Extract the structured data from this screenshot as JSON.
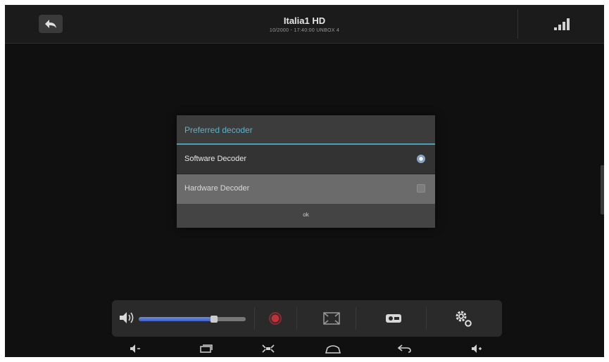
{
  "header": {
    "channel_name": "Italia1 HD",
    "channel_info": "10/2000 - 17:40:00 UNBOX 4",
    "back_icon": "back-arrow-icon",
    "signal_icon": "signal-strength-icon"
  },
  "dialog": {
    "title": "Preferred decoder",
    "options": [
      {
        "label": "Software Decoder",
        "selected": true
      },
      {
        "label": "Hardware Decoder",
        "selected": false
      }
    ],
    "ok_label": "ok"
  },
  "controls": {
    "volume_level": 0.72,
    "volume_icon": "speaker-icon",
    "record_icon": "record-icon",
    "aspect_icon": "aspect-ratio-icon",
    "subtitle_icon": "audio-track-icon",
    "settings_icon": "gear-icon"
  },
  "navigation": {
    "items": [
      "volume-down-icon",
      "recent-apps-icon",
      "screenshot-icon",
      "home-icon",
      "back-icon",
      "volume-up-icon"
    ]
  },
  "colors": {
    "accent": "#4a9fb5",
    "slider_fill": "#3d5fc2",
    "record": "#c0323a"
  }
}
